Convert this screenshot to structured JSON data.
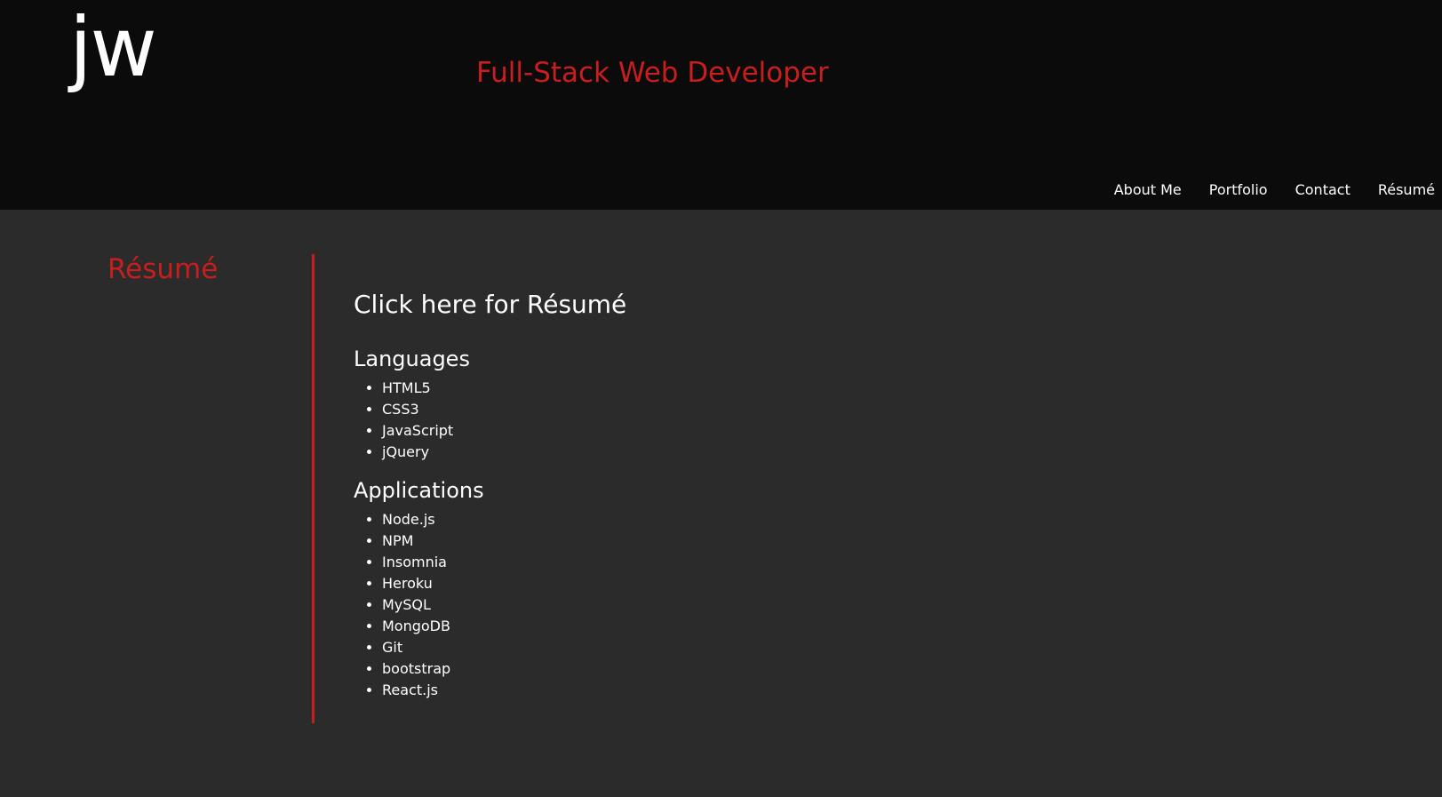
{
  "header": {
    "logo": "jw",
    "tagline": "Full-Stack Web Developer",
    "nav": [
      {
        "label": "About Me"
      },
      {
        "label": "Portfolio"
      },
      {
        "label": "Contact"
      },
      {
        "label": "Résumé"
      }
    ]
  },
  "main": {
    "section_title": "Résumé",
    "resume_link": "Click here for Résumé",
    "languages": {
      "heading": "Languages",
      "items": [
        "HTML5",
        "CSS3",
        "JavaScript",
        "jQuery"
      ]
    },
    "applications": {
      "heading": "Applications",
      "items": [
        "Node.js",
        "NPM",
        "Insomnia",
        "Heroku",
        "MySQL",
        "MongoDB",
        "Git",
        "bootstrap",
        "React.js"
      ]
    }
  },
  "colors": {
    "accent": "#c81e1e",
    "header_bg": "#0b0b0b",
    "page_bg": "#2b2b2b",
    "text": "#ffffff"
  }
}
